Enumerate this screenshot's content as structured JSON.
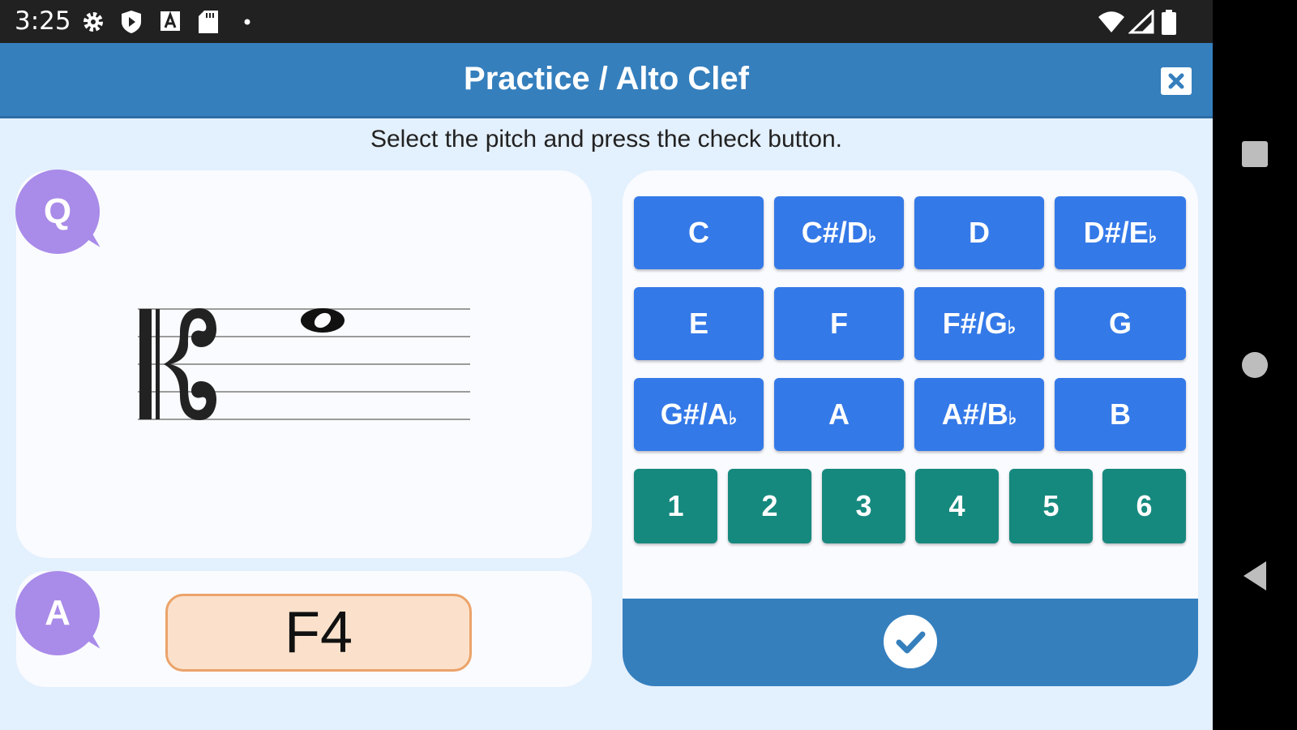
{
  "status_bar": {
    "time": "3:25"
  },
  "app_bar": {
    "title": "Practice / Alto Clef"
  },
  "instruction": "Select the pitch and press the check button.",
  "question": {
    "badge": "Q",
    "clef": "alto",
    "note": "whole note"
  },
  "answer": {
    "badge": "A",
    "value": "F4"
  },
  "pitch_buttons": [
    {
      "main": "C",
      "flat": ""
    },
    {
      "main": "C#/D",
      "flat": "♭"
    },
    {
      "main": "D",
      "flat": ""
    },
    {
      "main": "D#/E",
      "flat": "♭"
    },
    {
      "main": "E",
      "flat": ""
    },
    {
      "main": "F",
      "flat": ""
    },
    {
      "main": "F#/G",
      "flat": "♭"
    },
    {
      "main": "G",
      "flat": ""
    },
    {
      "main": "G#/A",
      "flat": "♭"
    },
    {
      "main": "A",
      "flat": ""
    },
    {
      "main": "A#/B",
      "flat": "♭"
    },
    {
      "main": "B",
      "flat": ""
    }
  ],
  "octave_buttons": [
    "1",
    "2",
    "3",
    "4",
    "5",
    "6"
  ],
  "colors": {
    "app_bar": "#357fbd",
    "pitch_button": "#3479e8",
    "octave_button": "#16897e",
    "badge": "#a98be9",
    "answer_fill": "#fbe1cb",
    "answer_border": "#eba36a"
  }
}
